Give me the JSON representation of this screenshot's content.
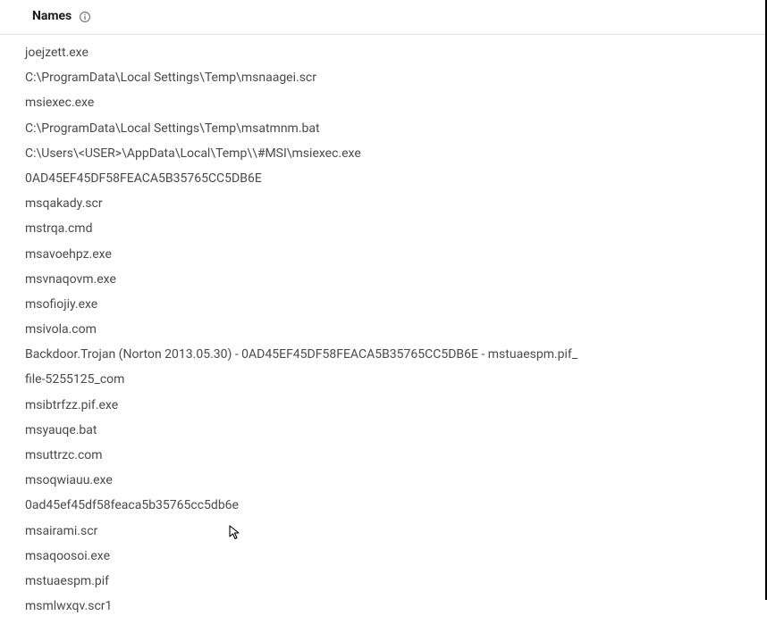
{
  "header": {
    "title": "Names"
  },
  "names": [
    "joejzett.exe",
    "C:\\ProgramData\\Local Settings\\Temp\\msnaagei.scr",
    "msiexec.exe",
    "C:\\ProgramData\\Local Settings\\Temp\\msatmnm.bat",
    "C:\\Users\\<USER>\\AppData\\Local\\Temp\\\\#MSI\\msiexec.exe",
    "0AD45EF45DF58FEACA5B35765CC5DB6E",
    "msqakady.scr",
    "mstrqa.cmd",
    "msavoehpz.exe",
    "msvnaqovm.exe",
    "msofiojiy.exe",
    "msivola.com",
    "Backdoor.Trojan (Norton 2013.05.30) - 0AD45EF45DF58FEACA5B35765CC5DB6E - mstuaespm.pif_",
    "file-5255125_com",
    "msibtrfzz.pif.exe",
    "msyauqe.bat",
    "msuttrzc.com",
    "msoqwiauu.exe",
    "0ad45ef45df58feaca5b35765cc5db6e",
    "msairami.scr",
    "msaqoosoi.exe",
    "mstuaespm.pif",
    "msmlwxqv.scr1"
  ]
}
